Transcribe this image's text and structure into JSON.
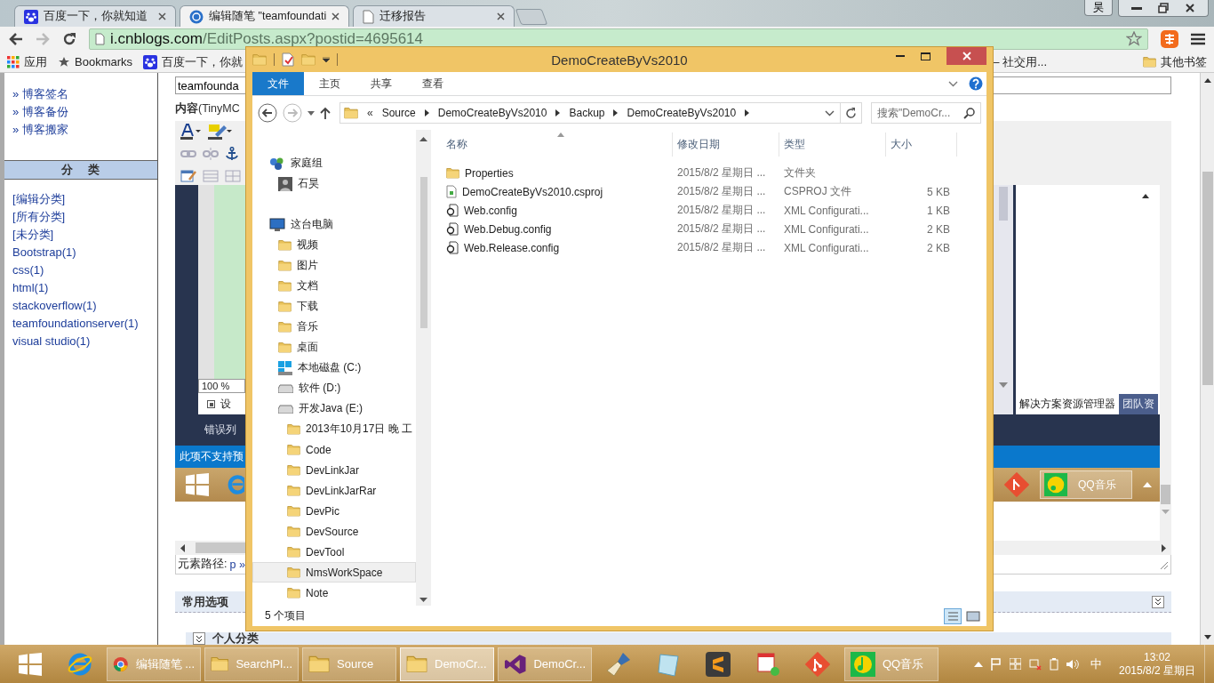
{
  "browser": {
    "tabs": [
      {
        "title": "百度一下，你就知道",
        "kind": "paw",
        "selected": false
      },
      {
        "title": "编辑随笔 \"teamfoundati",
        "kind": "blog",
        "selected": true
      },
      {
        "title": "迁移报告",
        "kind": "page",
        "selected": false
      }
    ],
    "profile": "昊",
    "url": {
      "host": "i.cnblogs.com",
      "path": "/EditPosts.aspx?postid=4695614"
    },
    "bookmarks": [
      {
        "label": "应用",
        "kind": "apps"
      },
      {
        "label": "Bookmarks",
        "kind": "star"
      },
      {
        "label": "百度一下，你就",
        "kind": "paw"
      }
    ],
    "bookmark_partial": "– 社交用...",
    "other_bookmarks": "其他书签"
  },
  "page": {
    "sidebar": {
      "links": [
        "» 博客签名",
        "» 博客备份",
        "» 博客搬家"
      ],
      "category_header": "分　类",
      "categories": [
        "[编辑分类]",
        "[所有分类]",
        "[未分类]",
        "Bootstrap(1)",
        "css(1)",
        "html(1)",
        "stackoverflow(1)",
        "teamfoundationserver(1)",
        "visual studio(1)"
      ]
    },
    "editor": {
      "title_value": "teamfounda",
      "content_label": "**内容**(TinyMC",
      "screenshot": {
        "zoom": "100 %",
        "design_tab": "设",
        "error_list": "错误列",
        "status": "此项不支持预",
        "taskbar_app": "QQ音乐",
        "panel_tabs": [
          {
            "label": "解决方案资源管理器",
            "selected": true
          },
          {
            "label": "团队资",
            "selected": false
          }
        ]
      },
      "path_label": "元素路径:",
      "path_value": "p »"
    },
    "panels": [
      {
        "title": "常用选项",
        "expanded": false
      },
      {
        "title": "个人分类",
        "expanded": true
      }
    ]
  },
  "explorer": {
    "title": "DemoCreateByVs2010",
    "ribbon_tabs": [
      {
        "label": "文件",
        "selected": true
      },
      {
        "label": "主页",
        "selected": false
      },
      {
        "label": "共享",
        "selected": false
      },
      {
        "label": "查看",
        "selected": false
      }
    ],
    "overflow": "«",
    "breadcrumbs": [
      "Source",
      "DemoCreateByVs2010",
      "Backup",
      "DemoCreateByVs2010"
    ],
    "search_placeholder": "搜索\"DemoCr...",
    "nav": [
      {
        "label": "家庭组",
        "kind": "homegroup",
        "selected": false,
        "children": [
          {
            "label": "石昊",
            "kind": "user",
            "selected": false
          }
        ]
      },
      {
        "label": "这台电脑",
        "kind": "computer",
        "selected": false,
        "children": [
          {
            "label": "视频",
            "kind": "folder",
            "selected": false
          },
          {
            "label": "图片",
            "kind": "folder",
            "selected": false
          },
          {
            "label": "文档",
            "kind": "folder",
            "selected": false
          },
          {
            "label": "下载",
            "kind": "folder",
            "selected": false
          },
          {
            "label": "音乐",
            "kind": "folder",
            "selected": false
          },
          {
            "label": "桌面",
            "kind": "folder",
            "selected": false
          },
          {
            "label": "本地磁盘 (C:)",
            "kind": "windows-drive",
            "selected": false
          },
          {
            "label": "软件 (D:)",
            "kind": "drive",
            "selected": false
          },
          {
            "label": "开发Java (E:)",
            "kind": "drive",
            "selected": false,
            "children": [
              {
                "label": "2013年10月17日 晚 工",
                "kind": "folder",
                "selected": false
              },
              {
                "label": "Code",
                "kind": "folder",
                "selected": false
              },
              {
                "label": "DevLinkJar",
                "kind": "folder",
                "selected": false
              },
              {
                "label": "DevLinkJarRar",
                "kind": "folder",
                "selected": false
              },
              {
                "label": "DevPic",
                "kind": "folder",
                "selected": false
              },
              {
                "label": "DevSource",
                "kind": "folder",
                "selected": false
              },
              {
                "label": "DevTool",
                "kind": "folder",
                "selected": false
              },
              {
                "label": "NmsWorkSpace",
                "kind": "folder",
                "selected": true
              },
              {
                "label": "Note",
                "kind": "folder",
                "selected": false
              }
            ]
          }
        ]
      }
    ],
    "columns": [
      {
        "label": "名称",
        "sorted": true
      },
      {
        "label": "修改日期",
        "sorted": false
      },
      {
        "label": "类型",
        "sorted": false
      },
      {
        "label": "大小",
        "sorted": false
      }
    ],
    "files": [
      {
        "name": "Properties",
        "modified": "2015/8/2 星期日 ...",
        "type": "文件夹",
        "kind": "folder"
      },
      {
        "name": "DemoCreateByVs2010.csproj",
        "modified": "2015/8/2 星期日 ...",
        "type": "CSPROJ 文件",
        "size": "5 KB",
        "kind": "csproj"
      },
      {
        "name": "Web.config",
        "modified": "2015/8/2 星期日 ...",
        "type": "XML Configurati...",
        "size": "1 KB",
        "kind": "config"
      },
      {
        "name": "Web.Debug.config",
        "modified": "2015/8/2 星期日 ...",
        "type": "XML Configurati...",
        "size": "2 KB",
        "kind": "config"
      },
      {
        "name": "Web.Release.config",
        "modified": "2015/8/2 星期日 ...",
        "type": "XML Configurati...",
        "size": "2 KB",
        "kind": "config"
      }
    ],
    "status": "5 个项目"
  },
  "taskbar": {
    "apps": [
      {
        "kind": "start"
      },
      {
        "kind": "ie"
      },
      {
        "kind": "chrome",
        "label": "编辑随笔 ...",
        "selected": false
      },
      {
        "kind": "folder",
        "label": "SearchPl...",
        "selected": false
      },
      {
        "kind": "folder",
        "label": "Source",
        "selected": false
      },
      {
        "kind": "folder",
        "label": "DemoCr...",
        "selected": true
      },
      {
        "kind": "vs",
        "label": "DemoCr...",
        "selected": false
      },
      {
        "kind": "brush"
      },
      {
        "kind": "notebook"
      },
      {
        "kind": "sublime"
      },
      {
        "kind": "notepad"
      },
      {
        "kind": "git"
      },
      {
        "kind": "qqmusic",
        "label": "QQ音乐",
        "selected": false
      }
    ],
    "ime": "中",
    "time": "13:02",
    "date": "2015/8/2 星期日"
  }
}
